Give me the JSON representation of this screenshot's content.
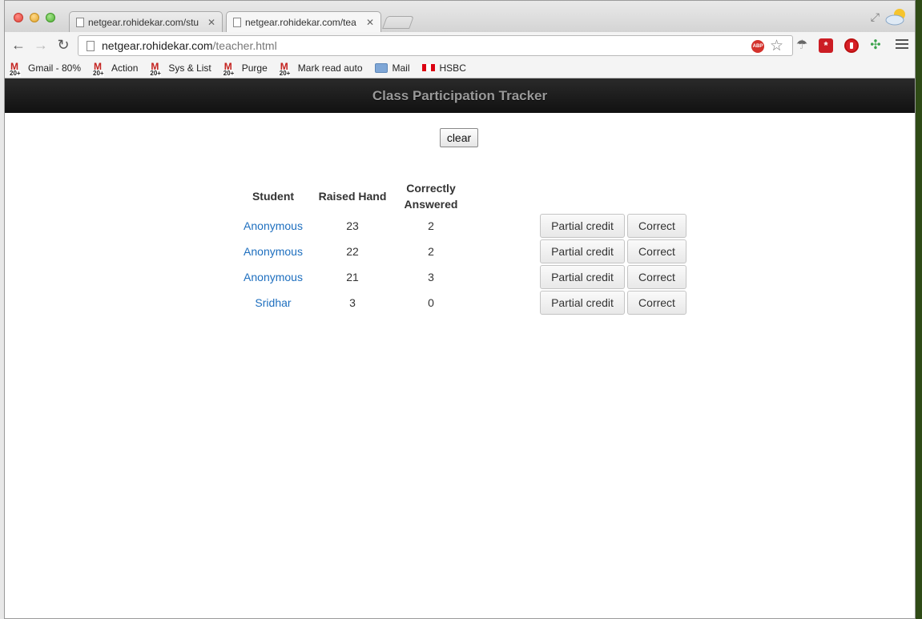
{
  "browser": {
    "tabs": [
      {
        "title": "netgear.rohidekar.com/stu"
      },
      {
        "title": "netgear.rohidekar.com/tea"
      }
    ],
    "url": {
      "host": "netgear.rohidekar.com",
      "path": "/teacher.html"
    },
    "bookmarks": [
      {
        "label": "Gmail - 80%",
        "icon": "gmail-icon",
        "badge": "20+"
      },
      {
        "label": "Action",
        "icon": "gmail-icon",
        "badge": "20+"
      },
      {
        "label": "Sys & List",
        "icon": "gmail-icon",
        "badge": "20+"
      },
      {
        "label": "Purge",
        "icon": "gmail-icon",
        "badge": "20+"
      },
      {
        "label": "Mark read auto",
        "icon": "gmail-icon",
        "badge": "20+"
      },
      {
        "label": "Mail",
        "icon": "folder-icon"
      },
      {
        "label": "HSBC",
        "icon": "hsbc-icon"
      }
    ]
  },
  "app": {
    "title": "Class Participation Tracker",
    "clear_label": "clear",
    "table": {
      "headers": {
        "student": "Student",
        "raised": "Raised Hand",
        "correct_line1": "Correctly",
        "correct_line2": "Answered"
      },
      "rows": [
        {
          "student": "Anonymous",
          "raised": "23",
          "correct": "2",
          "partial_label": "Partial credit",
          "correct_label": "Correct"
        },
        {
          "student": "Anonymous",
          "raised": "22",
          "correct": "2",
          "partial_label": "Partial credit",
          "correct_label": "Correct"
        },
        {
          "student": "Anonymous",
          "raised": "21",
          "correct": "3",
          "partial_label": "Partial credit",
          "correct_label": "Correct"
        },
        {
          "student": "Sridhar",
          "raised": "3",
          "correct": "0",
          "partial_label": "Partial credit",
          "correct_label": "Correct"
        }
      ]
    }
  },
  "colors": {
    "header_bg": "#1a1a1a",
    "header_text": "#999999",
    "link": "#1e6fbf"
  }
}
